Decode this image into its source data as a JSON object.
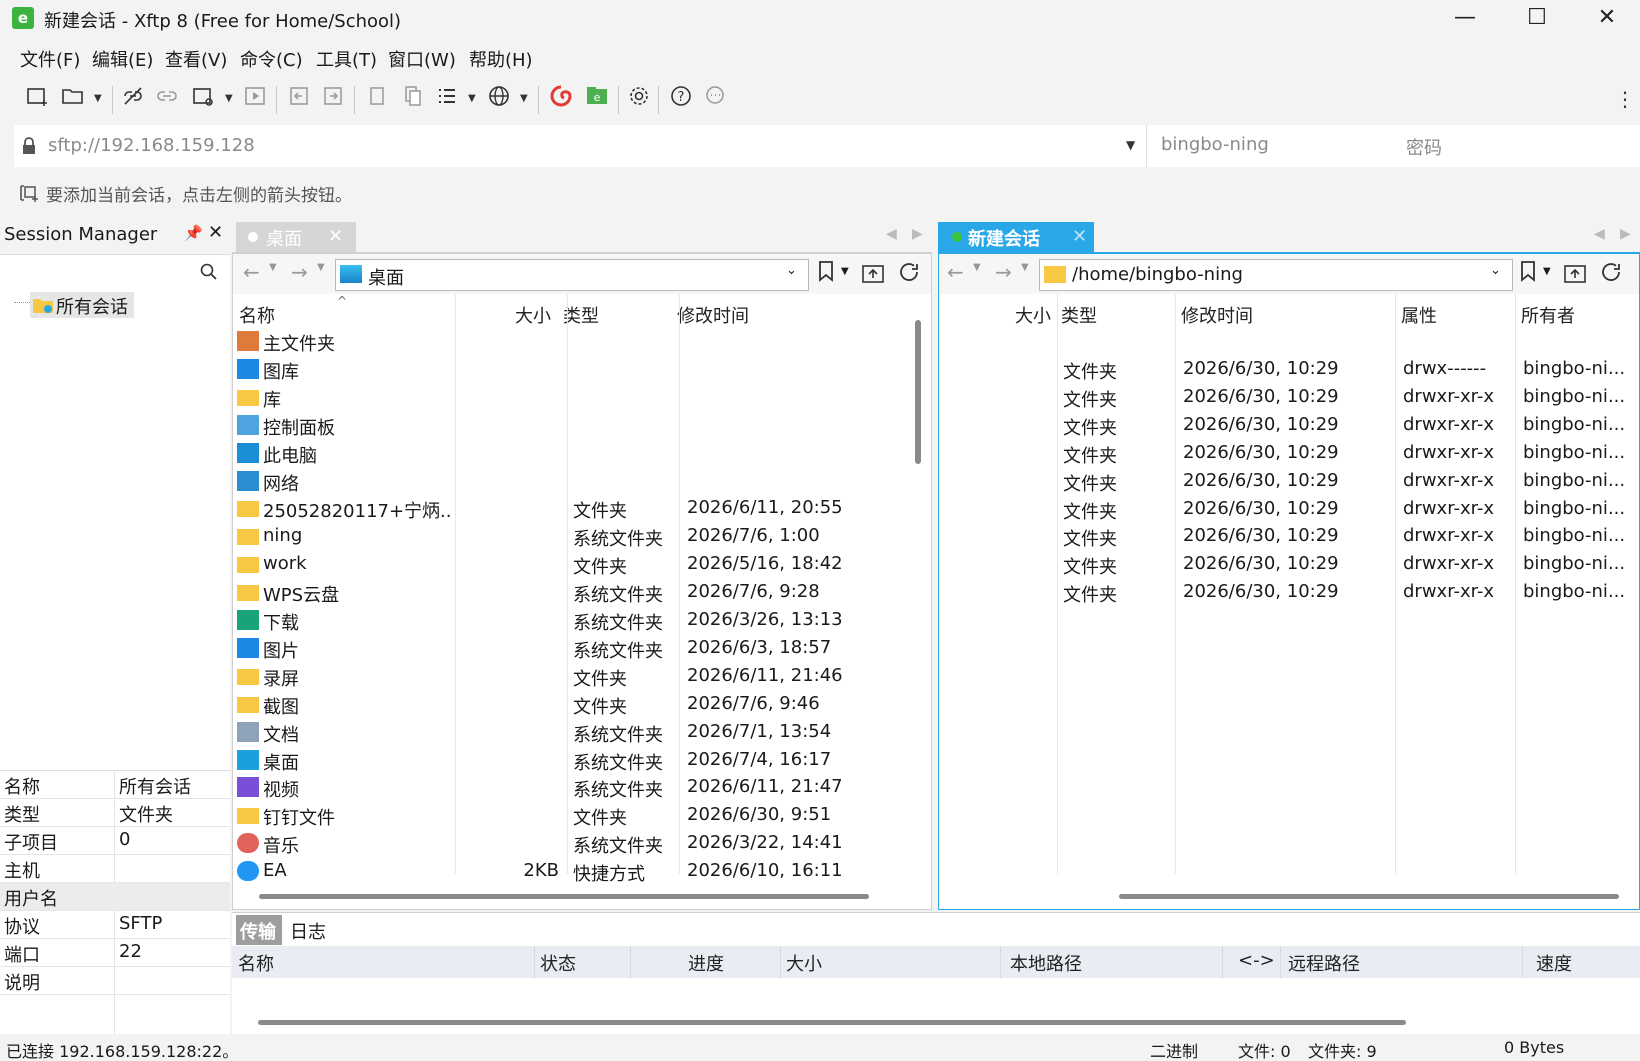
{
  "window": {
    "title": "新建会话 - Xftp 8 (Free for Home/School)",
    "minimize": "—",
    "maximize": "☐",
    "close": "✕"
  },
  "menu": [
    "文件(F)",
    "编辑(E)",
    "查看(V)",
    "命令(C)",
    "工具(T)",
    "窗口(W)",
    "帮助(H)"
  ],
  "address": {
    "url_placeholder": "sftp://192.168.159.128",
    "user_placeholder": "bingbo-ning",
    "password_placeholder": "密码"
  },
  "hint": "要添加当前会话，点击左侧的箭头按钮。",
  "session_manager": {
    "title": "Session Manager",
    "tree_root": "所有会话",
    "props": [
      {
        "k": "名称",
        "v": "所有会话"
      },
      {
        "k": "类型",
        "v": "文件夹"
      },
      {
        "k": "子项目",
        "v": "0"
      },
      {
        "k": "主机",
        "v": ""
      },
      {
        "k": "用户名",
        "v": ""
      },
      {
        "k": "协议",
        "v": "SFTP"
      },
      {
        "k": "端口",
        "v": "22"
      },
      {
        "k": "说明",
        "v": ""
      }
    ]
  },
  "local": {
    "tab": "桌面",
    "path": "桌面",
    "headers": {
      "name": "名称",
      "size": "大小",
      "type": "类型",
      "mtime": "修改时间"
    },
    "rows": [
      {
        "name": "主文件夹",
        "size": "",
        "type": "",
        "mtime": "",
        "icon": "home-icon"
      },
      {
        "name": "图库",
        "size": "",
        "type": "",
        "mtime": "",
        "icon": "gallery-icon"
      },
      {
        "name": "库",
        "size": "",
        "type": "",
        "mtime": "",
        "icon": "folder-icon"
      },
      {
        "name": "控制面板",
        "size": "",
        "type": "",
        "mtime": "",
        "icon": "control-panel-icon"
      },
      {
        "name": "此电脑",
        "size": "",
        "type": "",
        "mtime": "",
        "icon": "monitor-icon"
      },
      {
        "name": "网络",
        "size": "",
        "type": "",
        "mtime": "",
        "icon": "network-icon"
      },
      {
        "name": "25052820117+宁炳...",
        "size": "",
        "type": "文件夹",
        "mtime": "2026/6/11, 20:55",
        "icon": "folder-icon"
      },
      {
        "name": "ning",
        "size": "",
        "type": "系统文件夹",
        "mtime": "2026/7/6, 1:00",
        "icon": "folder-icon"
      },
      {
        "name": "work",
        "size": "",
        "type": "文件夹",
        "mtime": "2026/5/16, 18:42",
        "icon": "folder-icon"
      },
      {
        "name": "WPS云盘",
        "size": "",
        "type": "系统文件夹",
        "mtime": "2026/7/6, 9:28",
        "icon": "folder-icon"
      },
      {
        "name": "下载",
        "size": "",
        "type": "系统文件夹",
        "mtime": "2026/3/26, 13:13",
        "icon": "download-icon"
      },
      {
        "name": "图片",
        "size": "",
        "type": "系统文件夹",
        "mtime": "2026/6/3, 18:57",
        "icon": "picture-icon"
      },
      {
        "name": "录屏",
        "size": "",
        "type": "文件夹",
        "mtime": "2026/6/11, 21:46",
        "icon": "folder-icon"
      },
      {
        "name": "截图",
        "size": "",
        "type": "文件夹",
        "mtime": "2026/7/6, 9:46",
        "icon": "folder-icon"
      },
      {
        "name": "文档",
        "size": "",
        "type": "系统文件夹",
        "mtime": "2026/7/1, 13:54",
        "icon": "document-icon"
      },
      {
        "name": "桌面",
        "size": "",
        "type": "系统文件夹",
        "mtime": "2026/7/4, 16:17",
        "icon": "desktop-icon"
      },
      {
        "name": "视频",
        "size": "",
        "type": "系统文件夹",
        "mtime": "2026/6/11, 21:47",
        "icon": "video-icon"
      },
      {
        "name": "钉钉文件",
        "size": "",
        "type": "文件夹",
        "mtime": "2026/6/30, 9:51",
        "icon": "folder-icon"
      },
      {
        "name": "音乐",
        "size": "",
        "type": "系统文件夹",
        "mtime": "2026/3/22, 14:41",
        "icon": "music-icon"
      },
      {
        "name": "EA",
        "size": "2KB",
        "type": "快捷方式",
        "mtime": "2026/6/10, 16:11",
        "icon": "ea-icon"
      }
    ]
  },
  "remote": {
    "tab": "新建会话",
    "path": "/home/bingbo-ning",
    "headers": {
      "size": "大小",
      "type": "类型",
      "mtime": "修改时间",
      "attr": "属性",
      "owner": "所有者"
    },
    "rows": [
      {
        "type": "文件夹",
        "mtime": "2026/6/30, 10:29",
        "attr": "drwx------",
        "owner": "bingbo-ni..."
      },
      {
        "type": "文件夹",
        "mtime": "2026/6/30, 10:29",
        "attr": "drwxr-xr-x",
        "owner": "bingbo-ni..."
      },
      {
        "type": "文件夹",
        "mtime": "2026/6/30, 10:29",
        "attr": "drwxr-xr-x",
        "owner": "bingbo-ni..."
      },
      {
        "type": "文件夹",
        "mtime": "2026/6/30, 10:29",
        "attr": "drwxr-xr-x",
        "owner": "bingbo-ni..."
      },
      {
        "type": "文件夹",
        "mtime": "2026/6/30, 10:29",
        "attr": "drwxr-xr-x",
        "owner": "bingbo-ni..."
      },
      {
        "type": "文件夹",
        "mtime": "2026/6/30, 10:29",
        "attr": "drwxr-xr-x",
        "owner": "bingbo-ni..."
      },
      {
        "type": "文件夹",
        "mtime": "2026/6/30, 10:29",
        "attr": "drwxr-xr-x",
        "owner": "bingbo-ni..."
      },
      {
        "type": "文件夹",
        "mtime": "2026/6/30, 10:29",
        "attr": "drwxr-xr-x",
        "owner": "bingbo-ni..."
      },
      {
        "type": "文件夹",
        "mtime": "2026/6/30, 10:29",
        "attr": "drwxr-xr-x",
        "owner": "bingbo-ni..."
      }
    ]
  },
  "transfer": {
    "tabs": [
      "传输",
      "日志"
    ],
    "headers": [
      "名称",
      "状态",
      "进度",
      "大小",
      "本地路径",
      "<->",
      "远程路径",
      "速度"
    ]
  },
  "status": {
    "connection": "已连接 192.168.159.128:22。",
    "mode": "二进制",
    "files": "文件: 0",
    "folders": "文件夹: 9",
    "bytes": "0 Bytes"
  },
  "colors": {
    "accent": "#2aa7e6",
    "connected": "#3cc43c",
    "folder": "#f7c843"
  }
}
